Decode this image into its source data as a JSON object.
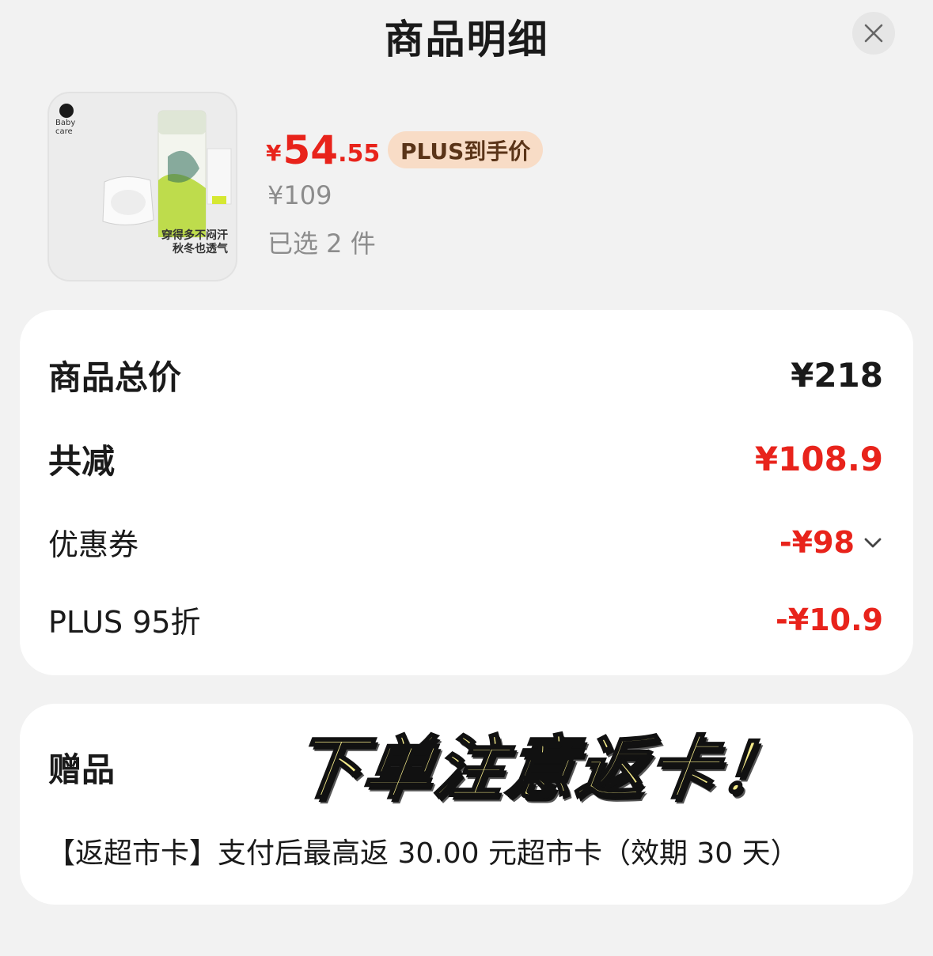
{
  "header": {
    "title": "商品明细",
    "close_icon": "close-icon"
  },
  "product": {
    "image_brand": "Baby\ncare",
    "image_caption_line1": "穿得多不闷汗",
    "image_caption_line2": "秋冬也透气",
    "price_symbol": "¥",
    "price_integer": "54",
    "price_decimal": ".55",
    "price_tag": "PLUS到手价",
    "original_price": "¥109",
    "selected_count": "已选 2 件"
  },
  "summary": {
    "total_label": "商品总价",
    "total_value": "¥218",
    "discount_label": "共减",
    "discount_value": "¥108.9",
    "coupon_label": "优惠券",
    "coupon_value": "-¥98",
    "plus_label": "PLUS 95折",
    "plus_value": "-¥10.9"
  },
  "gift": {
    "label": "赠品",
    "description": "【返超市卡】支付后最高返 30.00 元超市卡（效期 30 天）",
    "overlay": "下单注意返卡！"
  },
  "colors": {
    "accent_red": "#e8231b",
    "plus_tag_bg": "#f8dcc6",
    "plus_tag_text": "#5a3418"
  }
}
